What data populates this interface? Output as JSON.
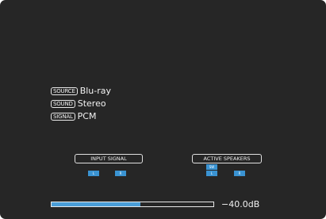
{
  "info": {
    "source": {
      "tag": "SOURCE",
      "value": "Blu-ray"
    },
    "sound": {
      "tag": "SOUND",
      "value": "Stereo"
    },
    "signal": {
      "tag": "SIGNAL",
      "value": "PCM"
    }
  },
  "input_signal": {
    "label": "INPUT SIGNAL",
    "channels": [
      "L",
      "R"
    ]
  },
  "active_speakers": {
    "label": "ACTIVE SPEAKERS",
    "channels": [
      "SW",
      "L",
      "R"
    ]
  },
  "volume": {
    "level_fraction": 0.55,
    "text": "−40.0dB"
  },
  "colors": {
    "background": "#262626",
    "channel_active": "#3a93d2",
    "volume_fill": "#4a9ed8"
  }
}
